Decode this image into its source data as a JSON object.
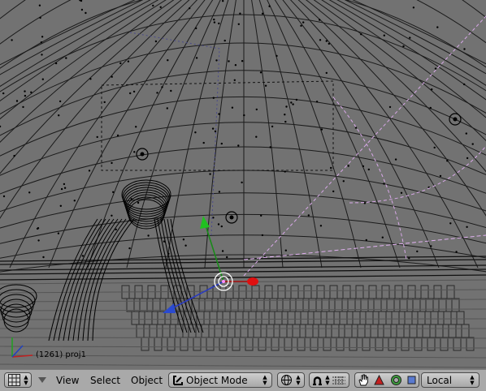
{
  "viewport": {
    "frame_label": "(1261) proj1"
  },
  "header": {
    "window_type_icon": "grid-icon",
    "collapse_icon": "triangle-down-icon",
    "menus": [
      "View",
      "Select",
      "Object"
    ],
    "mode_label": "Object Mode",
    "draw_type_icon": "sphere-wire-icon",
    "pivot_icon": "pivot-icon",
    "layers_icon": "layers-grid-icon",
    "manipulator_icons": [
      "hand-icon",
      "triangle-icon",
      "circle-icon",
      "square-icon"
    ],
    "orientation_label": "Local"
  }
}
